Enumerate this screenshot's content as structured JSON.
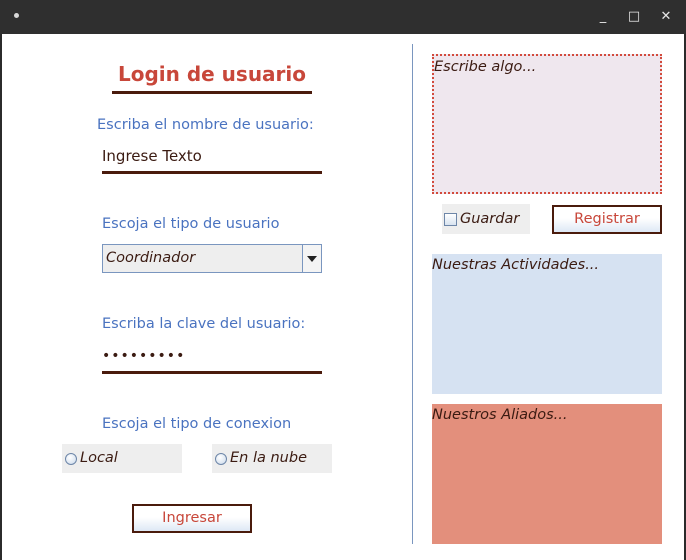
{
  "window": {
    "menu_icon": "dot-icon",
    "controls": [
      "minimize-icon",
      "maximize-icon",
      "close-icon"
    ],
    "minimize_glyph": "_",
    "maximize_glyph": "□",
    "close_glyph": "✕"
  },
  "left": {
    "title": "Login de usuario",
    "username_label": "Escriba el nombre de usuario:",
    "username_value": "Ingrese Texto",
    "usertype_label": "Escoja el tipo de usuario",
    "usertype_selected": "Coordinador",
    "password_label": "Escriba la clave del usuario:",
    "password_value": "•••••••••",
    "connection_label": "Escoja el tipo de conexion",
    "radio_local": "Local",
    "radio_cloud": "En la nube",
    "login_button": "Ingresar"
  },
  "right": {
    "textarea_placeholder": "Escribe algo...",
    "save_checkbox": "Guardar",
    "register_button": "Registrar",
    "activities_text": "Nuestras Actividades...",
    "allies_text": "Nuestros Aliados..."
  },
  "colors": {
    "title": "#c8473a",
    "label": "#4a73c0",
    "underline": "#4a1b0c",
    "textarea_bg": "#efe7ee",
    "activities_bg": "#d6e2f2",
    "allies_bg": "#e38f7c"
  }
}
